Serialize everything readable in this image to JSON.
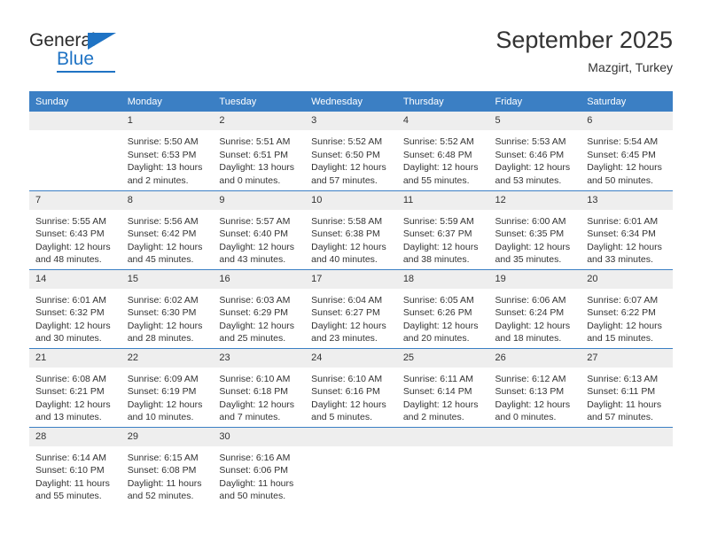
{
  "brand": {
    "name_part1": "General",
    "name_part2": "Blue",
    "logo_icon": "triangle-flag-icon",
    "accent_color": "#1f73c4"
  },
  "header": {
    "title": "September 2025",
    "subtitle": "Mazgirt, Turkey"
  },
  "calendar": {
    "header_bg": "#3b7fc4",
    "daynum_bg": "#eeeeee",
    "weekday_headers": [
      "Sunday",
      "Monday",
      "Tuesday",
      "Wednesday",
      "Thursday",
      "Friday",
      "Saturday"
    ],
    "weeks": [
      [
        {
          "day": "",
          "lines": []
        },
        {
          "day": "1",
          "lines": [
            "Sunrise: 5:50 AM",
            "Sunset: 6:53 PM",
            "Daylight: 13 hours",
            "and 2 minutes."
          ]
        },
        {
          "day": "2",
          "lines": [
            "Sunrise: 5:51 AM",
            "Sunset: 6:51 PM",
            "Daylight: 13 hours",
            "and 0 minutes."
          ]
        },
        {
          "day": "3",
          "lines": [
            "Sunrise: 5:52 AM",
            "Sunset: 6:50 PM",
            "Daylight: 12 hours",
            "and 57 minutes."
          ]
        },
        {
          "day": "4",
          "lines": [
            "Sunrise: 5:52 AM",
            "Sunset: 6:48 PM",
            "Daylight: 12 hours",
            "and 55 minutes."
          ]
        },
        {
          "day": "5",
          "lines": [
            "Sunrise: 5:53 AM",
            "Sunset: 6:46 PM",
            "Daylight: 12 hours",
            "and 53 minutes."
          ]
        },
        {
          "day": "6",
          "lines": [
            "Sunrise: 5:54 AM",
            "Sunset: 6:45 PM",
            "Daylight: 12 hours",
            "and 50 minutes."
          ]
        }
      ],
      [
        {
          "day": "7",
          "lines": [
            "Sunrise: 5:55 AM",
            "Sunset: 6:43 PM",
            "Daylight: 12 hours",
            "and 48 minutes."
          ]
        },
        {
          "day": "8",
          "lines": [
            "Sunrise: 5:56 AM",
            "Sunset: 6:42 PM",
            "Daylight: 12 hours",
            "and 45 minutes."
          ]
        },
        {
          "day": "9",
          "lines": [
            "Sunrise: 5:57 AM",
            "Sunset: 6:40 PM",
            "Daylight: 12 hours",
            "and 43 minutes."
          ]
        },
        {
          "day": "10",
          "lines": [
            "Sunrise: 5:58 AM",
            "Sunset: 6:38 PM",
            "Daylight: 12 hours",
            "and 40 minutes."
          ]
        },
        {
          "day": "11",
          "lines": [
            "Sunrise: 5:59 AM",
            "Sunset: 6:37 PM",
            "Daylight: 12 hours",
            "and 38 minutes."
          ]
        },
        {
          "day": "12",
          "lines": [
            "Sunrise: 6:00 AM",
            "Sunset: 6:35 PM",
            "Daylight: 12 hours",
            "and 35 minutes."
          ]
        },
        {
          "day": "13",
          "lines": [
            "Sunrise: 6:01 AM",
            "Sunset: 6:34 PM",
            "Daylight: 12 hours",
            "and 33 minutes."
          ]
        }
      ],
      [
        {
          "day": "14",
          "lines": [
            "Sunrise: 6:01 AM",
            "Sunset: 6:32 PM",
            "Daylight: 12 hours",
            "and 30 minutes."
          ]
        },
        {
          "day": "15",
          "lines": [
            "Sunrise: 6:02 AM",
            "Sunset: 6:30 PM",
            "Daylight: 12 hours",
            "and 28 minutes."
          ]
        },
        {
          "day": "16",
          "lines": [
            "Sunrise: 6:03 AM",
            "Sunset: 6:29 PM",
            "Daylight: 12 hours",
            "and 25 minutes."
          ]
        },
        {
          "day": "17",
          "lines": [
            "Sunrise: 6:04 AM",
            "Sunset: 6:27 PM",
            "Daylight: 12 hours",
            "and 23 minutes."
          ]
        },
        {
          "day": "18",
          "lines": [
            "Sunrise: 6:05 AM",
            "Sunset: 6:26 PM",
            "Daylight: 12 hours",
            "and 20 minutes."
          ]
        },
        {
          "day": "19",
          "lines": [
            "Sunrise: 6:06 AM",
            "Sunset: 6:24 PM",
            "Daylight: 12 hours",
            "and 18 minutes."
          ]
        },
        {
          "day": "20",
          "lines": [
            "Sunrise: 6:07 AM",
            "Sunset: 6:22 PM",
            "Daylight: 12 hours",
            "and 15 minutes."
          ]
        }
      ],
      [
        {
          "day": "21",
          "lines": [
            "Sunrise: 6:08 AM",
            "Sunset: 6:21 PM",
            "Daylight: 12 hours",
            "and 13 minutes."
          ]
        },
        {
          "day": "22",
          "lines": [
            "Sunrise: 6:09 AM",
            "Sunset: 6:19 PM",
            "Daylight: 12 hours",
            "and 10 minutes."
          ]
        },
        {
          "day": "23",
          "lines": [
            "Sunrise: 6:10 AM",
            "Sunset: 6:18 PM",
            "Daylight: 12 hours",
            "and 7 minutes."
          ]
        },
        {
          "day": "24",
          "lines": [
            "Sunrise: 6:10 AM",
            "Sunset: 6:16 PM",
            "Daylight: 12 hours",
            "and 5 minutes."
          ]
        },
        {
          "day": "25",
          "lines": [
            "Sunrise: 6:11 AM",
            "Sunset: 6:14 PM",
            "Daylight: 12 hours",
            "and 2 minutes."
          ]
        },
        {
          "day": "26",
          "lines": [
            "Sunrise: 6:12 AM",
            "Sunset: 6:13 PM",
            "Daylight: 12 hours",
            "and 0 minutes."
          ]
        },
        {
          "day": "27",
          "lines": [
            "Sunrise: 6:13 AM",
            "Sunset: 6:11 PM",
            "Daylight: 11 hours",
            "and 57 minutes."
          ]
        }
      ],
      [
        {
          "day": "28",
          "lines": [
            "Sunrise: 6:14 AM",
            "Sunset: 6:10 PM",
            "Daylight: 11 hours",
            "and 55 minutes."
          ]
        },
        {
          "day": "29",
          "lines": [
            "Sunrise: 6:15 AM",
            "Sunset: 6:08 PM",
            "Daylight: 11 hours",
            "and 52 minutes."
          ]
        },
        {
          "day": "30",
          "lines": [
            "Sunrise: 6:16 AM",
            "Sunset: 6:06 PM",
            "Daylight: 11 hours",
            "and 50 minutes."
          ]
        },
        {
          "day": "",
          "lines": []
        },
        {
          "day": "",
          "lines": []
        },
        {
          "day": "",
          "lines": []
        },
        {
          "day": "",
          "lines": []
        }
      ]
    ]
  }
}
